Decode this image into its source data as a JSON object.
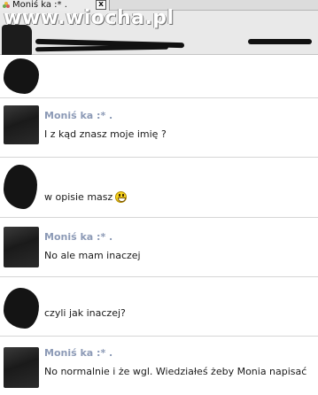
{
  "tab": {
    "title": "Moniś ka :* .",
    "close_label": "x"
  },
  "watermark": "www.wiocha.pl",
  "messages": [
    {
      "name": "",
      "text": ""
    },
    {
      "name": "Moniś ka :* .",
      "text": "I z kąd znasz moje imię ?"
    },
    {
      "name": "",
      "text": "w opisie masz"
    },
    {
      "name": "Moniś ka :* .",
      "text": "No ale mam inaczej"
    },
    {
      "name": "",
      "text": "czyli jak inaczej?"
    },
    {
      "name": "Moniś ka :* .",
      "text": "No normalnie i że wgl. Wiedziałeś żeby Monia napisać"
    }
  ],
  "colors": {
    "name": "#8c9ab6",
    "text": "#1a1a1a",
    "divider": "#d6d6d6"
  }
}
